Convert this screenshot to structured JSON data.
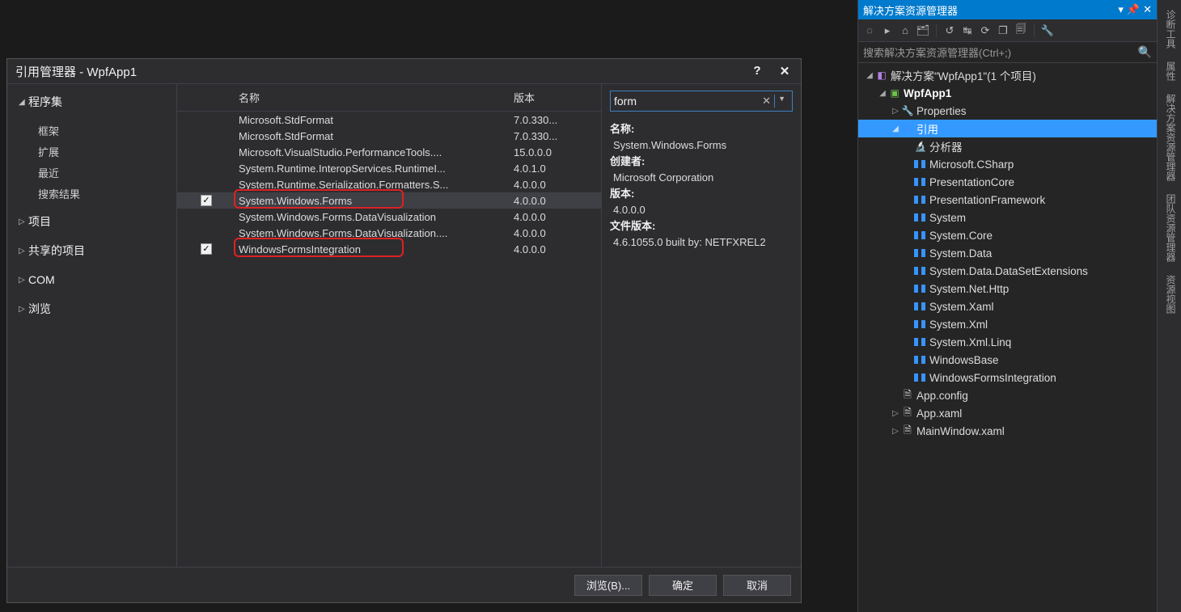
{
  "solution_explorer": {
    "title": "解决方案资源管理器",
    "search_placeholder": "搜索解决方案资源管理器(Ctrl+;)",
    "solution_label": "解决方案\"WpfApp1\"(1 个项目)",
    "project": "WpfApp1",
    "properties": "Properties",
    "references_label": "引用",
    "references": [
      "分析器",
      "Microsoft.CSharp",
      "PresentationCore",
      "PresentationFramework",
      "System",
      "System.Core",
      "System.Data",
      "System.Data.DataSetExtensions",
      "System.Net.Http",
      "System.Xaml",
      "System.Xml",
      "System.Xml.Linq",
      "WindowsBase",
      "WindowsFormsIntegration"
    ],
    "app_config": "App.config",
    "app_xaml": "App.xaml",
    "mainwindow_xaml": "MainWindow.xaml"
  },
  "vtabs": [
    "诊断工具",
    "属性",
    "解决方案资源管理器",
    "团队资源管理器",
    "资源视图"
  ],
  "dialog": {
    "title": "引用管理器 - WpfApp1",
    "nav": {
      "assemblies": "程序集",
      "framework": "框架",
      "extensions": "扩展",
      "recent": "最近",
      "search_results": "搜索结果",
      "projects": "项目",
      "shared_projects": "共享的项目",
      "com": "COM",
      "browse": "浏览"
    },
    "columns": {
      "name": "名称",
      "version": "版本"
    },
    "rows": [
      {
        "name": "Microsoft.StdFormat",
        "ver": "7.0.330..."
      },
      {
        "name": "Microsoft.StdFormat",
        "ver": "7.0.330..."
      },
      {
        "name": "Microsoft.VisualStudio.PerformanceTools....",
        "ver": "15.0.0.0"
      },
      {
        "name": "System.Runtime.InteropServices.RuntimeI...",
        "ver": "4.0.1.0"
      },
      {
        "name": "System.Runtime.Serialization.Formatters.S...",
        "ver": "4.0.0.0"
      },
      {
        "name": "System.Windows.Forms",
        "ver": "4.0.0.0",
        "checked": true,
        "sel": true,
        "mark": true
      },
      {
        "name": "System.Windows.Forms.DataVisualization",
        "ver": "4.0.0.0"
      },
      {
        "name": "System.Windows.Forms.DataVisualization....",
        "ver": "4.0.0.0"
      },
      {
        "name": "WindowsFormsIntegration",
        "ver": "4.0.0.0",
        "checked": true,
        "mark": true
      }
    ],
    "search_value": "form",
    "detail": {
      "name_label": "名称:",
      "name_value": "System.Windows.Forms",
      "creator_label": "创建者:",
      "creator_value": "Microsoft Corporation",
      "version_label": "版本:",
      "version_value": "4.0.0.0",
      "filever_label": "文件版本:",
      "filever_value": "4.6.1055.0 built by: NETFXREL2"
    },
    "buttons": {
      "browse": "浏览(B)...",
      "ok": "确定",
      "cancel": "取消"
    }
  }
}
